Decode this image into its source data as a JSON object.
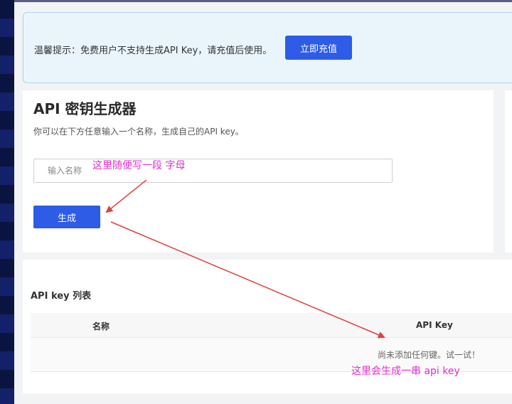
{
  "notice": {
    "text": "温馨提示：免费用户不支持生成API Key，请充值后使用。",
    "recharge_label": "立即充值"
  },
  "generator": {
    "title": "API 密钥生成器",
    "description": "你可以在下方任意输入一个名称，生成自己的API key。",
    "input_placeholder": "输入名称",
    "generate_label": "生成"
  },
  "list": {
    "title": "API key 列表",
    "columns": [
      "名称",
      "API Key"
    ],
    "empty_text": "尚未添加任何键。试一试！"
  },
  "annotations": {
    "input_hint": "这里随便写一段 字母",
    "output_hint": "这里会生成一串 api key",
    "color": "#e030d0",
    "arrow_color": "#e04040"
  },
  "colors": {
    "accent": "#2e5ce6",
    "notice_bg": "#eaf5fb",
    "notice_border": "#a9d4ea"
  }
}
